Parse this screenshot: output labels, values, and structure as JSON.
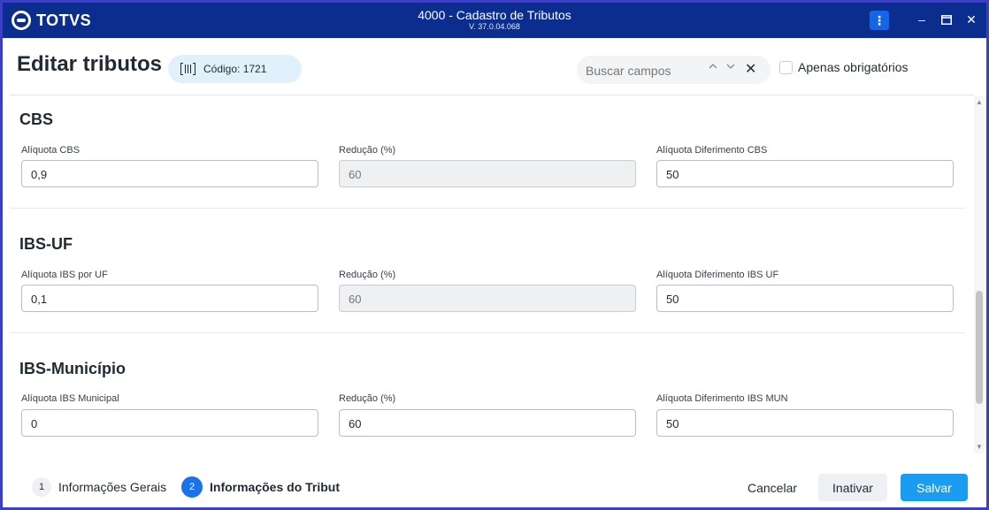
{
  "window": {
    "brand": "TOTVS",
    "title": "4000 - Cadastro de Tributos",
    "version": "V. 37.0.04.068",
    "menu_icon": "kebab-icon",
    "controls": [
      "minimize-icon",
      "maximize-icon",
      "close-icon"
    ],
    "accent_color": "#0b2d8e"
  },
  "header": {
    "title": "Editar tributos",
    "code_chip": "Código: 1721",
    "search_placeholder": "Buscar campos",
    "only_required_label": "Apenas obrigatórios"
  },
  "sections": [
    {
      "title": "CBS",
      "fields": [
        {
          "label": "Alíquota CBS",
          "value": "0,9",
          "disabled": false
        },
        {
          "label": "Redução (%)",
          "value": "60",
          "disabled": true
        },
        {
          "label": "Alíquota Diferimento CBS",
          "value": "50",
          "disabled": false
        }
      ]
    },
    {
      "title": "IBS-UF",
      "fields": [
        {
          "label": "Alíquota IBS por UF",
          "value": "0,1",
          "disabled": false
        },
        {
          "label": "Redução (%)",
          "value": "60",
          "disabled": true
        },
        {
          "label": "Alíquota Diferimento IBS UF",
          "value": "50",
          "disabled": false
        }
      ]
    },
    {
      "title": "IBS-Município",
      "fields": [
        {
          "label": "Alíquota IBS Municipal",
          "value": "0",
          "disabled": false
        },
        {
          "label": "Redução (%)",
          "value": "60",
          "disabled": false
        },
        {
          "label": "Alíquota Diferimento IBS MUN",
          "value": "50",
          "disabled": false
        }
      ]
    }
  ],
  "stepper": [
    {
      "number": "1",
      "label": "Informações Gerais",
      "active": false
    },
    {
      "number": "2",
      "label": "Informações do Tribut",
      "active": true
    }
  ],
  "footer": {
    "cancel_label": "Cancelar",
    "inactivate_label": "Inativar",
    "save_label": "Salvar"
  }
}
